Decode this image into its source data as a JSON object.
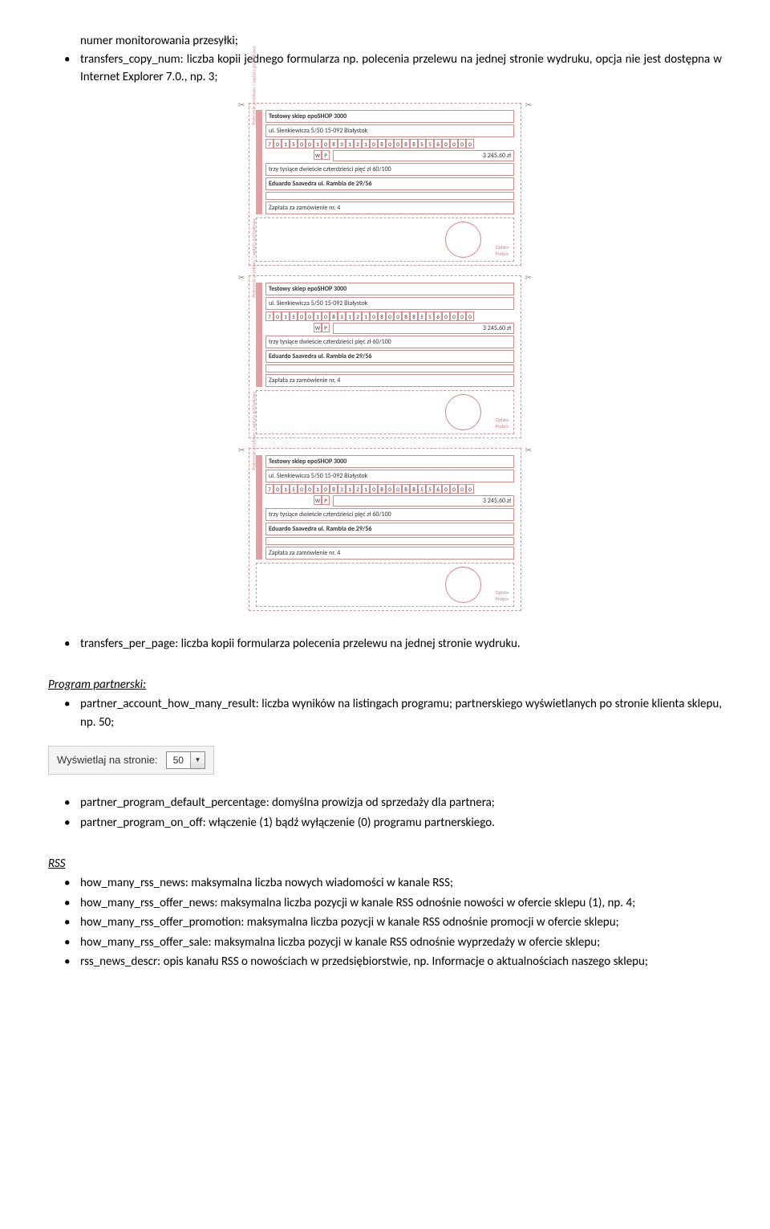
{
  "intro": {
    "line1": "numer monitorowania przesyłki;",
    "line2_pre": "transfers_copy_num: liczba kopii jednego formularza np. polecenia przelewu na jednej stronie wydruku, opcja nie jest dostępna w Internet Explorer 7.0., np. 3;"
  },
  "form_slip": {
    "shop_name": "Testowy sklep epoSHOP 3000",
    "shop_addr": "ul. Sienkiewicza 5/50 15-092 Białystok",
    "account_digits": [
      "7",
      "0",
      "1",
      "5",
      "0",
      "0",
      "1",
      "0",
      "8",
      "3",
      "1",
      "2",
      "1",
      "0",
      "8",
      "0",
      "0",
      "8",
      "8",
      "5",
      "5",
      "6",
      "0",
      "0",
      "0",
      "0"
    ],
    "currency": [
      "W",
      "P"
    ],
    "amount": "3 245.60 zł",
    "amount_words": "trzy tysiące dwieście czterdzieści pięć zł 60/100",
    "payer": "Eduardo Saavedra ul. Rambla de 29/56",
    "title": "Zapłata za zamówienie nr. 4",
    "stamp_label1": "Opłata",
    "stamp_label2": "Podpis",
    "vertical": "Polecenie przelewu / wpłata gotówkowa"
  },
  "after_forms": {
    "bullet_transfers_per_page": "transfers_per_page: liczba kopii formularza polecenia przelewu na jednej stronie wydruku."
  },
  "partner_heading": "Program partnerski:",
  "partner": {
    "b1": "partner_account_how_many_result: liczba wyników na listingach programu; partnerskiego wyświetlanych po stronie klienta sklepu, np. 50;"
  },
  "dropdown": {
    "label": "Wyświetlaj na stronie:",
    "value": "50"
  },
  "partner2": {
    "b1": "partner_program_default_percentage: domyślna prowizja od sprzedaży dla partnera;",
    "b2": "partner_program_on_off: włączenie (1) bądź wyłączenie (0) programu partnerskiego."
  },
  "rss_heading": "RSS",
  "rss": {
    "b1": "how_many_rss_news: maksymalna liczba nowych wiadomości w kanale RSS;",
    "b2": "how_many_rss_offer_news: maksymalna liczba pozycji w kanale RSS odnośnie nowości w ofercie sklepu (1), np. 4;",
    "b3": "how_many_rss_offer_promotion: maksymalna liczba pozycji w kanale RSS odnośnie promocji w ofercie sklepu;",
    "b4": "how_many_rss_offer_sale: maksymalna liczba pozycji w kanale RSS odnośnie wyprzedaży w ofercie sklepu;",
    "b5": "rss_news_descr: opis kanału RSS o nowościach w przedsiębiorstwie, np. Informacje o aktualnościach naszego sklepu;"
  }
}
